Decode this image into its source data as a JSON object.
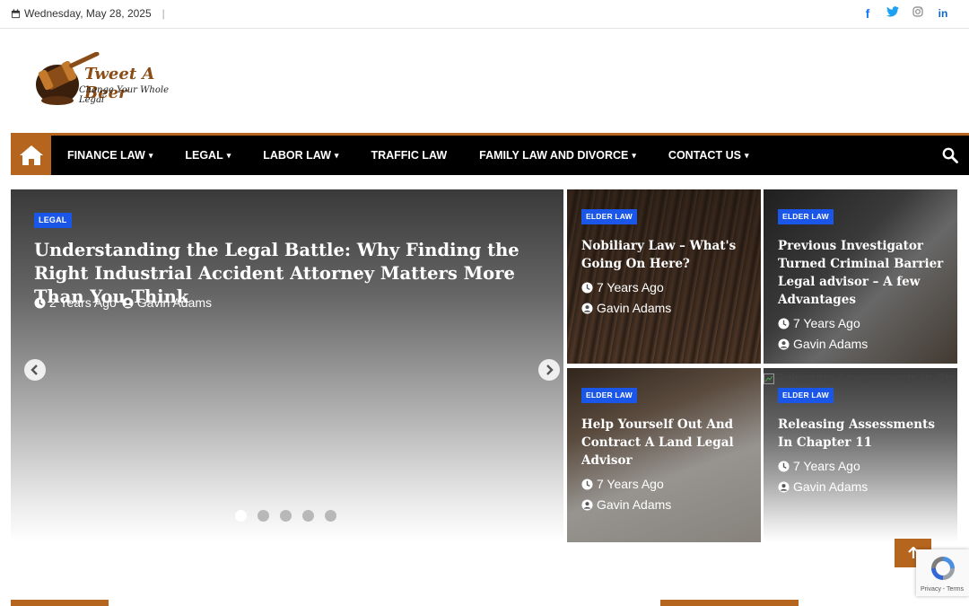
{
  "topbar": {
    "date": "Wednesday, May 28, 2025",
    "separator": "|",
    "social": [
      {
        "icon": "facebook-icon",
        "glyph": "f",
        "color": "#1877f2"
      },
      {
        "icon": "twitter-icon",
        "glyph": "t",
        "color": "#1da1f2"
      },
      {
        "icon": "instagram-icon",
        "glyph": "◎",
        "color": "#888888"
      },
      {
        "icon": "linkedin-icon",
        "glyph": "in",
        "color": "#0a66c2"
      }
    ]
  },
  "logo": {
    "brand": "Tweet A Beer",
    "tagline": "Change Your Whole Legal"
  },
  "nav": {
    "items": [
      {
        "label": "FINANCE LAW",
        "has_dropdown": true
      },
      {
        "label": "LEGAL",
        "has_dropdown": true
      },
      {
        "label": "LABOR LAW",
        "has_dropdown": true
      },
      {
        "label": "TRAFFIC LAW",
        "has_dropdown": false
      },
      {
        "label": "FAMILY LAW AND DIVORCE",
        "has_dropdown": true
      },
      {
        "label": "CONTACT US",
        "has_dropdown": true
      }
    ],
    "chevron": "▾",
    "accent": "#b5651d"
  },
  "slider": {
    "badge": "LEGAL",
    "headline": "Understanding the Legal Battle: Why Finding the Right Industrial Accident Attorney Matters More Than You Think",
    "time": "2 Years Ago",
    "author": "Gavin Adams",
    "dots_total": 5,
    "active_dot": 1
  },
  "cards": [
    {
      "badge": "ELDER LAW",
      "title": "Nobiliary Law – What's Going On Here?",
      "time": "7 Years Ago",
      "author": "Gavin Adams"
    },
    {
      "badge": "ELDER LAW",
      "title": "Previous Investigator Turned Criminal Barrier Legal advisor – A few Advantages",
      "time": "7 Years Ago",
      "author": "Gavin Adams"
    },
    {
      "badge": "ELDER LAW",
      "title": "Help Yourself Out And Contract A Land Legal Advisor",
      "time": "7 Years Ago",
      "author": "Gavin Adams"
    },
    {
      "badge": "ELDER LAW",
      "title": "Releasing Assessments In Chapter 11",
      "time": "7 Years Ago",
      "author": "Gavin Adams",
      "broken_image_alt": "Releasing Assessments In Chapter 11"
    }
  ],
  "recaptcha": {
    "links": "Privacy - Terms"
  },
  "colors": {
    "accent": "#b5651d",
    "badge": "#1a56e8",
    "nav_bg": "#000000"
  }
}
